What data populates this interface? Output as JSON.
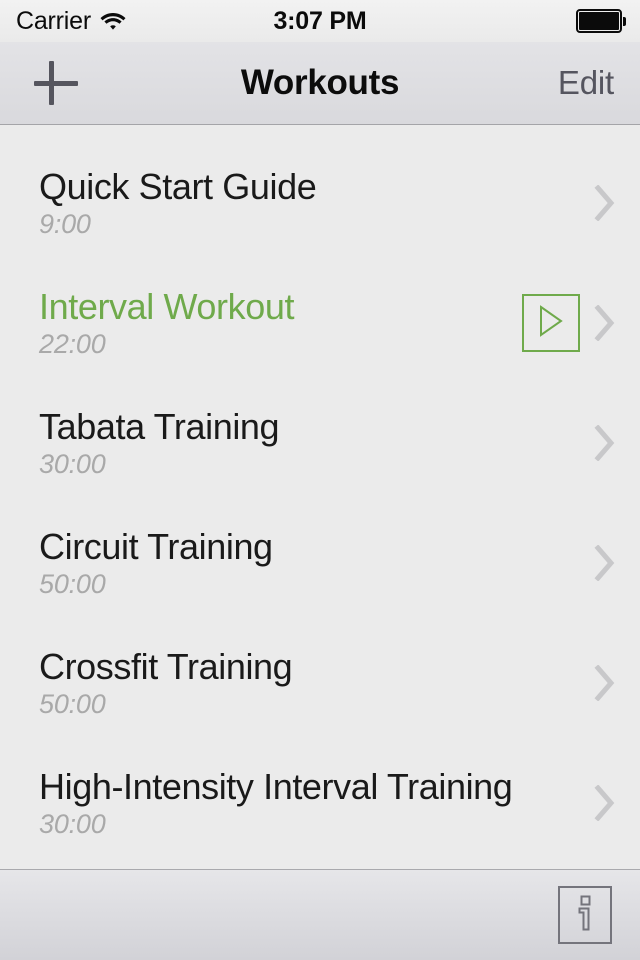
{
  "status_bar": {
    "carrier": "Carrier",
    "wifi_icon": "wifi-icon",
    "time": "3:07 PM",
    "battery_icon": "battery-full-icon"
  },
  "nav_bar": {
    "add_icon": "plus-icon",
    "title": "Workouts",
    "edit_label": "Edit"
  },
  "colors": {
    "accent_green": "#6faa4b",
    "list_background": "#ebebeb",
    "title_text": "#1a1a1a",
    "subtitle_text": "#a9a9a9",
    "chevron": "#c8c8ca",
    "nav_button_text": "#55555f"
  },
  "list": {
    "rows": [
      {
        "title": "Quick Start Guide",
        "duration": "9:00",
        "active": false,
        "has_play_button": false,
        "chevron_icon": "chevron-right-icon"
      },
      {
        "title": "Interval Workout",
        "duration": "22:00",
        "active": true,
        "has_play_button": true,
        "play_icon": "play-icon",
        "chevron_icon": "chevron-right-icon"
      },
      {
        "title": "Tabata Training",
        "duration": "30:00",
        "active": false,
        "has_play_button": false,
        "chevron_icon": "chevron-right-icon"
      },
      {
        "title": "Circuit Training",
        "duration": "50:00",
        "active": false,
        "has_play_button": false,
        "chevron_icon": "chevron-right-icon"
      },
      {
        "title": "Crossfit Training",
        "duration": "50:00",
        "active": false,
        "has_play_button": false,
        "chevron_icon": "chevron-right-icon"
      },
      {
        "title": "High-Intensity Interval Training",
        "duration": "30:00",
        "active": false,
        "has_play_button": false,
        "chevron_icon": "chevron-right-icon"
      }
    ]
  },
  "toolbar": {
    "info_icon": "info-icon"
  }
}
